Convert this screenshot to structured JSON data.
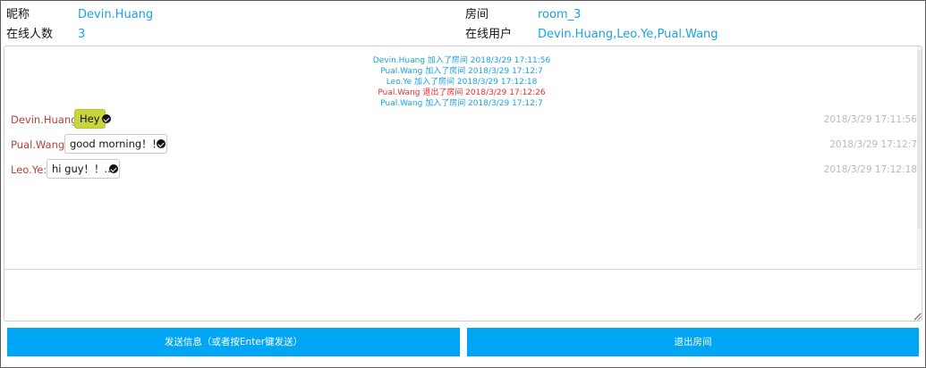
{
  "header": {
    "nickname_label": "昵称",
    "nickname_value": "Devin.Huang",
    "room_label": "房间",
    "room_value": "room_3",
    "online_count_label": "在线人数",
    "online_count_value": "3",
    "online_users_label": "在线用户",
    "online_users_value": "Devin.Huang,Leo.Ye,Pual.Wang"
  },
  "system_log": [
    {
      "text": "Devin.Huang 加入了房间 2018/3/29 17:11:56",
      "type": "join"
    },
    {
      "text": "Pual.Wang 加入了房间 2018/3/29 17:12:7",
      "type": "join"
    },
    {
      "text": "Leo.Ye 加入了房间 2018/3/29 17:12:18",
      "type": "join"
    },
    {
      "text": "Pual.Wang 退出了房间 2018/3/29 17:12:26",
      "type": "leave"
    },
    {
      "text": "Pual.Wang 加入了房间 2018/3/29 17:12:7",
      "type": "join"
    }
  ],
  "messages": [
    {
      "sender": "Devin.Huang:",
      "text": "Hey",
      "time": "2018/3/29 17:11:56",
      "self": true,
      "status_icon": "check-circle-icon"
    },
    {
      "sender": "Pual.Wang:",
      "text": "good morning！！",
      "time": "2018/3/29 17:12:7",
      "self": false,
      "status_icon": "check-circle-icon"
    },
    {
      "sender": "Leo.Ye:",
      "text": "hi guy！！...",
      "time": "2018/3/29 17:12:18",
      "self": false,
      "status_icon": "check-circle-icon"
    }
  ],
  "composer": {
    "value": "",
    "placeholder": ""
  },
  "actions": {
    "send_label": "发送信息（或者按Enter键发送）",
    "exit_label": "退出房间"
  },
  "colors": {
    "accent": "#00a6f4",
    "info_value": "#1aa1e6",
    "sender_name": "#b0433a",
    "leave_notice": "#ef2b2b",
    "self_bubble": "#c7d63f"
  }
}
